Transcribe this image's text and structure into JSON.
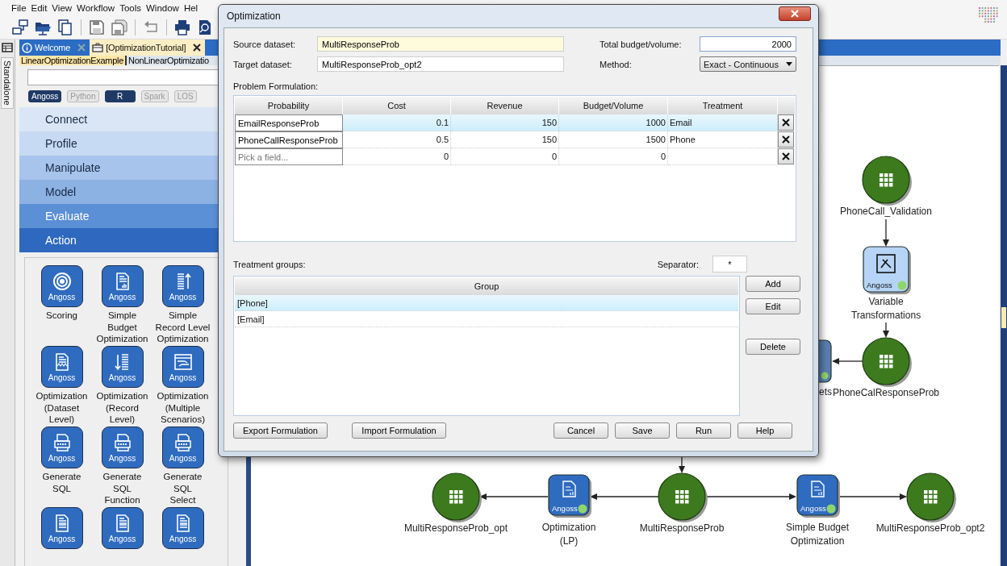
{
  "menu": [
    "File",
    "Edit",
    "View",
    "Workflow",
    "Tools",
    "Window",
    "Hel"
  ],
  "side_strip": {
    "label": "Standalone"
  },
  "tabs": [
    {
      "label": "Welcome",
      "selected": false
    },
    {
      "label": "[OptimizationTutorial]",
      "selected": true
    }
  ],
  "subtabs": [
    {
      "label": "LinearOptimizationExample",
      "selected": true
    },
    {
      "label": "NonLinearOptimizatio",
      "selected": false
    }
  ],
  "languages": [
    {
      "label": "Angoss",
      "on": true
    },
    {
      "label": "Python",
      "on": false
    },
    {
      "label": "R",
      "on": true
    },
    {
      "label": "Spark",
      "on": false
    },
    {
      "label": "LOS",
      "on": false
    }
  ],
  "categories": [
    {
      "label": "Connect",
      "color": "#dae6f6"
    },
    {
      "label": "Profile",
      "color": "#c6daf3"
    },
    {
      "label": "Manipulate",
      "color": "#a7c4ec"
    },
    {
      "label": "Model",
      "color": "#8cb1e3"
    },
    {
      "label": "Evaluate",
      "color": "#5b8fd6"
    },
    {
      "label": "Action",
      "color": "#2e68bf"
    }
  ],
  "palette": [
    {
      "badge": "Angoss",
      "label": "Scoring"
    },
    {
      "badge": "Angoss",
      "label": "Simple\nBudget\nOptimization"
    },
    {
      "badge": "Angoss",
      "label": "Simple\nRecord Level\nOptimization"
    },
    {
      "badge": "Angoss",
      "label": "Optimization\n(Dataset\nLevel)"
    },
    {
      "badge": "Angoss",
      "label": "Optimization\n(Record\nLevel)"
    },
    {
      "badge": "Angoss",
      "label": "Optimization\n(Multiple\nScenarios)"
    },
    {
      "badge": "Angoss",
      "label": "Generate\nSQL"
    },
    {
      "badge": "Angoss",
      "label": "Generate\nSQL\nFunction"
    },
    {
      "badge": "Angoss",
      "label": "Generate\nSQL\nSelect"
    },
    {
      "badge": "Angoss"
    },
    {
      "badge": "Angoss"
    },
    {
      "badge": "Angoss"
    }
  ],
  "canvas": {
    "nodes": [
      {
        "kind": "dataset",
        "label": "PhoneCall_Validation"
      },
      {
        "kind": "tool",
        "badge": "Angoss",
        "label": "Variable\nTransformations"
      },
      {
        "kind": "partial",
        "label": "ets"
      },
      {
        "kind": "dataset",
        "label": "PhoneCalResponseProb"
      },
      {
        "kind": "dataset",
        "label": "MultiResponseProb_opt"
      },
      {
        "kind": "tool",
        "badge": "Angoss",
        "label": "Optimization\n(LP)"
      },
      {
        "kind": "dataset",
        "label": "MultiResponseProb"
      },
      {
        "kind": "tool",
        "badge": "Angoss",
        "label": "Simple Budget\nOptimization"
      },
      {
        "kind": "dataset",
        "label": "MultiResponseProb_opt2"
      }
    ]
  },
  "dialog": {
    "title": "Optimization",
    "source_label": "Source dataset:",
    "source_value": "MultiResponseProb",
    "target_label": "Target dataset:",
    "target_value": "MultiResponseProb_opt2",
    "budget_label": "Total budget/volume:",
    "budget_value": "2000",
    "method_label": "Method:",
    "method_value": "Exact - Continuous",
    "formulation_label": "Problem Formulation:",
    "columns": [
      "Probability",
      "Cost",
      "Revenue",
      "Budget/Volume",
      "Treatment"
    ],
    "rows": [
      {
        "probability": "EmailResponseProb",
        "cost": "0.1",
        "revenue": "150",
        "budget": "1000",
        "treatment": "Email",
        "selected": true
      },
      {
        "probability": "PhoneCallResponseProb",
        "cost": "0.5",
        "revenue": "150",
        "budget": "1500",
        "treatment": "Phone",
        "selected": false
      },
      {
        "placeholder": "Pick a field...",
        "cost": "0",
        "revenue": "0",
        "budget": "0",
        "selected": false
      }
    ],
    "groups_label": "Treatment groups:",
    "separator_label": "Separator:",
    "separator_value": "*",
    "group_column": "Group",
    "groups": [
      {
        "label": "[Phone]",
        "selected": true
      },
      {
        "label": "[Email]",
        "selected": false
      }
    ],
    "side_buttons": [
      "Add",
      "Edit",
      "Delete"
    ],
    "left_buttons": [
      "Export Formulation",
      "Import Formulation"
    ],
    "right_buttons": [
      "Cancel",
      "Save",
      "Run",
      "Help"
    ]
  }
}
